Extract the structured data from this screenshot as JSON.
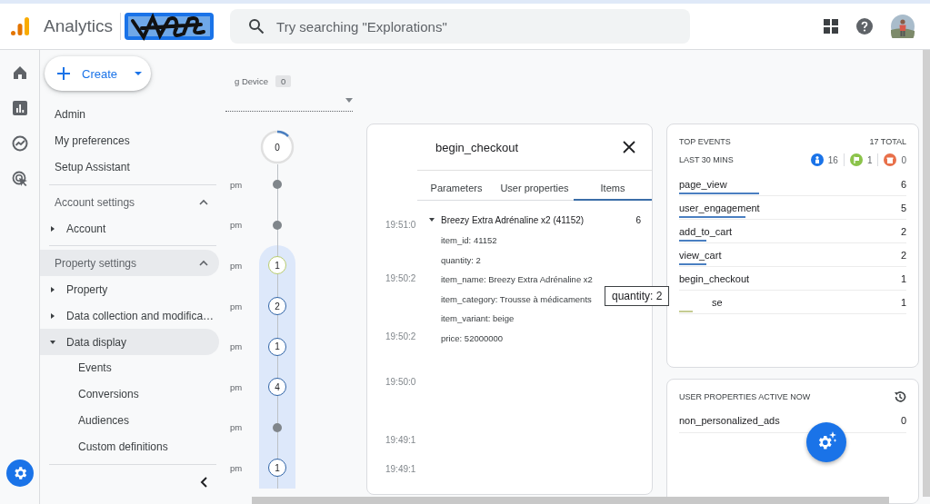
{
  "header": {
    "app_name": "Analytics",
    "search": {
      "placeholder": "Try searching \"Explorations\""
    }
  },
  "nav": {
    "create_label": "Create",
    "links": [
      {
        "label": "Admin"
      },
      {
        "label": "My preferences"
      },
      {
        "label": "Setup Assistant"
      }
    ],
    "sections": [
      {
        "title": "Account settings",
        "expanded": true,
        "selected": false,
        "items": [
          {
            "label": "Account",
            "expanded": false,
            "selected": false
          }
        ]
      },
      {
        "title": "Property settings",
        "expanded": true,
        "selected": true,
        "items": [
          {
            "label": "Property",
            "expanded": false,
            "selected": false
          },
          {
            "label": "Data collection and modifica…",
            "expanded": false,
            "selected": false
          },
          {
            "label": "Data display",
            "expanded": true,
            "selected": true,
            "children": [
              {
                "label": "Events"
              },
              {
                "label": "Conversions"
              },
              {
                "label": "Audiences"
              },
              {
                "label": "Custom definitions"
              }
            ]
          }
        ]
      }
    ]
  },
  "timeline": {
    "filter_label": "g Device",
    "filter_count": "0",
    "counter": {
      "value": "0"
    },
    "rows": [
      {
        "time": "pm",
        "kind": "dot",
        "highlighted": false
      },
      {
        "time": "pm",
        "kind": "dot",
        "highlighted": false
      },
      {
        "time": "pm",
        "kind": "count",
        "count": "1",
        "color": "#b9cc6e",
        "highlighted": true
      },
      {
        "time": "pm",
        "kind": "count",
        "count": "2",
        "color": "#2f63a6",
        "highlighted": true
      },
      {
        "time": "pm",
        "kind": "count",
        "count": "1",
        "color": "#2f63a6",
        "highlighted": true
      },
      {
        "time": "pm",
        "kind": "count",
        "count": "4",
        "color": "#2f63a6",
        "highlighted": true
      },
      {
        "time": "pm",
        "kind": "dot",
        "highlighted": true
      },
      {
        "time": "pm",
        "kind": "count",
        "count": "1",
        "color": "#2f63a6",
        "highlighted": true
      }
    ]
  },
  "detail": {
    "title": "begin_checkout",
    "tabs": [
      {
        "label": "Parameters",
        "selected": false
      },
      {
        "label": "User properties",
        "selected": false
      },
      {
        "label": "Items",
        "selected": true
      }
    ],
    "times": [
      "19:51:0",
      "19:50:2",
      "19:50:2",
      "19:50:0",
      "19:49:1",
      "19:49:1"
    ],
    "item": {
      "name": "Breezy Extra Adrénaline x2 (41152)",
      "count": "6",
      "expanded": true,
      "params": [
        "item_id: 41152",
        "quantity: 2",
        "item_name: Breezy Extra Adrénaline x2",
        "item_category: Trousse à médicaments",
        "item_variant: beige",
        "price: 52000000"
      ]
    }
  },
  "tooltip": "quantity: 2",
  "top_events": {
    "title": "TOP EVENTS",
    "total": "17 TOTAL",
    "period": "LAST 30 MINS",
    "counts": [
      {
        "kind": "user",
        "value": "16",
        "color": "#1a73e8"
      },
      {
        "kind": "flag",
        "value": "1",
        "color": "#8bc34a"
      },
      {
        "kind": "gift",
        "value": "0",
        "color": "#e8704a"
      }
    ],
    "events": [
      {
        "name": "page_view",
        "value": "6",
        "level": 0.35,
        "color": "#4a7fc1",
        "covered": false
      },
      {
        "name": "user_engagement",
        "value": "5",
        "level": 0.29,
        "color": "#4a7fc1",
        "covered": false
      },
      {
        "name": "add_to_cart",
        "value": "2",
        "level": 0.12,
        "color": "#4a7fc1",
        "covered": false
      },
      {
        "name": "view_cart",
        "value": "2",
        "level": 0.12,
        "color": "#4a7fc1",
        "covered": false
      },
      {
        "name": "begin_checkout",
        "value": "1",
        "covered": false
      },
      {
        "name": "se",
        "value": "1",
        "level": 0.06,
        "color": "#c5cc92",
        "covered": true
      }
    ]
  },
  "user_properties": {
    "title": "USER PROPERTIES ACTIVE NOW",
    "rows": [
      {
        "name": "non_personalized_ads",
        "value": "0"
      }
    ]
  }
}
